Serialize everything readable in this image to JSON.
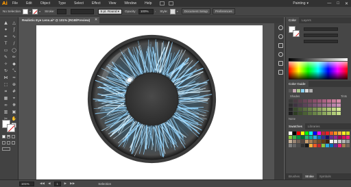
{
  "app": {
    "logo": "Ai"
  },
  "menu": {
    "items": [
      "File",
      "Edit",
      "Object",
      "Type",
      "Select",
      "Effect",
      "View",
      "Window",
      "Help"
    ],
    "workspace": "Painting",
    "window_controls": [
      "—",
      "□",
      "✕"
    ]
  },
  "control_bar": {
    "selection_label": "No Selection",
    "stroke_label": "Stroke:",
    "brush_value": "5 pt. Round",
    "opacity_label": "Opacity:",
    "opacity_value": "100%",
    "style_label": "Style:",
    "document_setup": "Document Setup",
    "preferences": "Preferences"
  },
  "document": {
    "tab_title": "Realistic Eye Lens.ai* @ 101% (RGB/Preview)",
    "close_glyph": "✕"
  },
  "tools": [
    "selection-icon",
    "direct-selection-icon",
    "magic-wand-icon",
    "lasso-icon",
    "pen-icon",
    "curvature-icon",
    "type-icon",
    "line-icon",
    "rectangle-icon",
    "ellipse-icon",
    "paintbrush-icon",
    "pencil-icon",
    "shaper-icon",
    "eraser-icon",
    "rotate-icon",
    "scale-icon",
    "width-icon",
    "warp-icon",
    "free-transform-icon",
    "shape-builder-icon",
    "perspective-icon",
    "mesh-icon",
    "gradient-icon",
    "eyedropper-icon",
    "blend-icon",
    "symbol-sprayer-icon",
    "graph-icon",
    "artboard-icon",
    "slice-icon",
    "hand-icon",
    "zoom-icon",
    "print-tiling-icon"
  ],
  "tool_glyphs": [
    "▲",
    "△",
    "✦",
    "ʃ",
    "✒",
    "∿",
    "T",
    "/",
    "▭",
    "◯",
    "✎",
    "✏",
    "✧",
    "◆",
    "↻",
    "⤡",
    "⋈",
    "≈",
    "⬚",
    "⊕",
    "⌗",
    "#",
    "▦",
    "⌖",
    "∞",
    "❋",
    "▥",
    "▣",
    "✂",
    "✋",
    "⚲",
    "⬜"
  ],
  "panels": {
    "top_tabs": [
      "Color",
      "Layers"
    ],
    "color_guide_tab": "Color Guide",
    "cg_labels": [
      "Shades",
      "Tints"
    ],
    "none_label": "None",
    "swatches_tabs": [
      "Swatches",
      "Libraries"
    ],
    "bottom_tabs": [
      "Brushes",
      "Stroke",
      "Symbols"
    ],
    "cg_colors": [
      "#3a3a3a",
      "#4a3a42",
      "#5a3e4c",
      "#6a4456",
      "#7a4a60",
      "#8a506a",
      "#9a5876",
      "#aa6282",
      "#bb6e8e",
      "#c97c9a",
      "#d68ca8",
      "#2f2f2f",
      "#3e3340",
      "#4d3a4c",
      "#5b4258",
      "#6a4b64",
      "#7a5572",
      "#8a5f80",
      "#9a6a8e",
      "#ab769c",
      "#bb84aa",
      "#cb92b8",
      "#262626",
      "#3a4a2e",
      "#4a5c36",
      "#5a6e40",
      "#6b804a",
      "#7c9254",
      "#8ea460",
      "#a0b66c",
      "#b2c87a",
      "#c4d888",
      "#d6e898",
      "#1e1e1e",
      "#2e3d24",
      "#3c4e2c",
      "#4a6034",
      "#5a723e",
      "#6a8448",
      "#7a9652",
      "#8ca85e",
      "#9eba6a",
      "#b0cc78",
      "#c2dc86"
    ],
    "swatches": [
      "#ffffff",
      "#000000",
      "#ff0000",
      "#ffff00",
      "#00ff00",
      "#00ffff",
      "#0000ff",
      "#ff00ff",
      "#c1272d",
      "#ed1c24",
      "#f15a24",
      "#f7931e",
      "#fbb03b",
      "#fcee21",
      "#d9e021",
      "#8cc63f",
      "#39b54a",
      "#009245",
      "#006837",
      "#22b573",
      "#00a99d",
      "#29abe2",
      "#0071bc",
      "#2e3192",
      "#1b1464",
      "#662d91",
      "#93278f",
      "#9e005d",
      "#d4145a",
      "#ed1e79",
      "#c7b299",
      "#998675",
      "#736357",
      "#534741",
      "#c69c6d",
      "#a67c52",
      "#8c6239",
      "#754c24",
      "#603813",
      "#42210b",
      "#f2f2f2",
      "#e6e6e6",
      "#cccccc",
      "#b3b3b3",
      "#999999",
      "#808080",
      "#666666",
      "#4d4d4d",
      "#333333",
      "#1a1a1a",
      "#fbb03b",
      "#f15a24",
      "#c1272d",
      "#8cc63f",
      "#29abe2",
      "#0071bc",
      "#662d91",
      "#ed1e79",
      "#a67c52",
      "#736357"
    ]
  },
  "status_bar": {
    "zoom": "101%",
    "page": "1",
    "arrows": [
      "◀◀",
      "◀",
      "▶",
      "▶▶"
    ],
    "tool_name": "Selection"
  },
  "eye": {
    "sclera_color": "#3a3a3a",
    "iris_fiber_color": "#8fd3ff",
    "pupil_color": "#3b3b3b",
    "highlight_color": "#ffffff"
  }
}
